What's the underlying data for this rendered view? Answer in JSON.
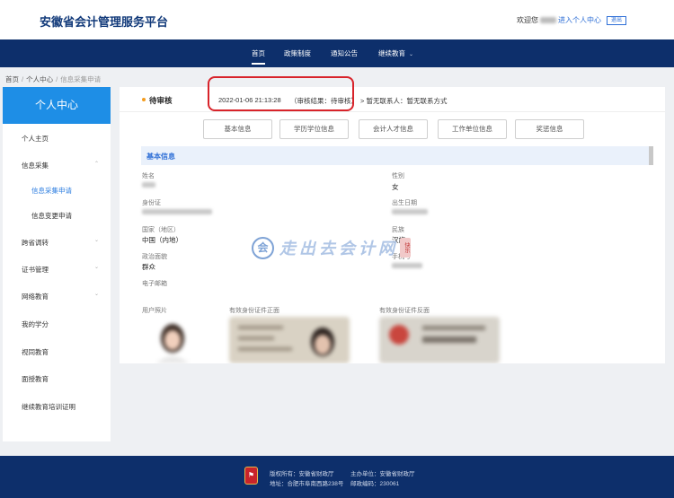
{
  "header": {
    "title": "安徽省会计管理服务平台",
    "welcome": "欢迎您",
    "enter_center": "进入个人中心",
    "logout": "退出"
  },
  "nav": {
    "items": [
      "首页",
      "政策制度",
      "通知公告",
      "继续教育"
    ],
    "active_index": 0
  },
  "breadcrumb": [
    "首页",
    "个人中心",
    "信息采集申请"
  ],
  "sidebar": {
    "title": "个人中心",
    "items": [
      {
        "label": "个人主页"
      },
      {
        "label": "信息采集"
      },
      {
        "label": "信息采集申请"
      },
      {
        "label": "信息变更申请"
      },
      {
        "label": "跨省调转"
      },
      {
        "label": "证书管理"
      },
      {
        "label": "网络教育"
      },
      {
        "label": "我的学分"
      },
      {
        "label": "视同教育"
      },
      {
        "label": "面授教育"
      },
      {
        "label": "继续教育培训证明"
      }
    ]
  },
  "status": {
    "label": "待审核",
    "time": "2022-01-06 21:13:28",
    "result": "（审核结果：待审核）",
    "next": "> 暂无联系人：暂无联系方式"
  },
  "tabs": [
    "基本信息",
    "学历学位信息",
    "会计人才信息",
    "工作单位信息",
    "奖惩信息"
  ],
  "section_title": "基本信息",
  "fields": {
    "name_label": "姓名",
    "gender_label": "性别",
    "gender_value": "女",
    "id_label": "身份证",
    "birth_label": "出生日期",
    "country_label": "国家（地区）",
    "country_value": "中国（内地）",
    "ethnic_label": "民族",
    "ethnic_value": "汉族",
    "politics_label": "政治面貌",
    "politics_value": "群众",
    "phone_label": "手机号",
    "email_label": "电子邮箱",
    "photo_label": "用户照片",
    "id_front_label": "有效身份证件正面",
    "id_back_label": "有效身份证件反面"
  },
  "watermark": {
    "mark": "会",
    "text": "走出去会计网",
    "seal": "快乐"
  },
  "footer": {
    "copyright": "版权所有：安徽省财政厅",
    "host": "主办单位：安徽省财政厅",
    "address": "地址：合肥市阜南西路238号",
    "postcode": "邮政编码：230061"
  },
  "colors": {
    "primary": "#0d2f6b",
    "accent": "#1e8ee6",
    "highlight": "#d8232a"
  }
}
